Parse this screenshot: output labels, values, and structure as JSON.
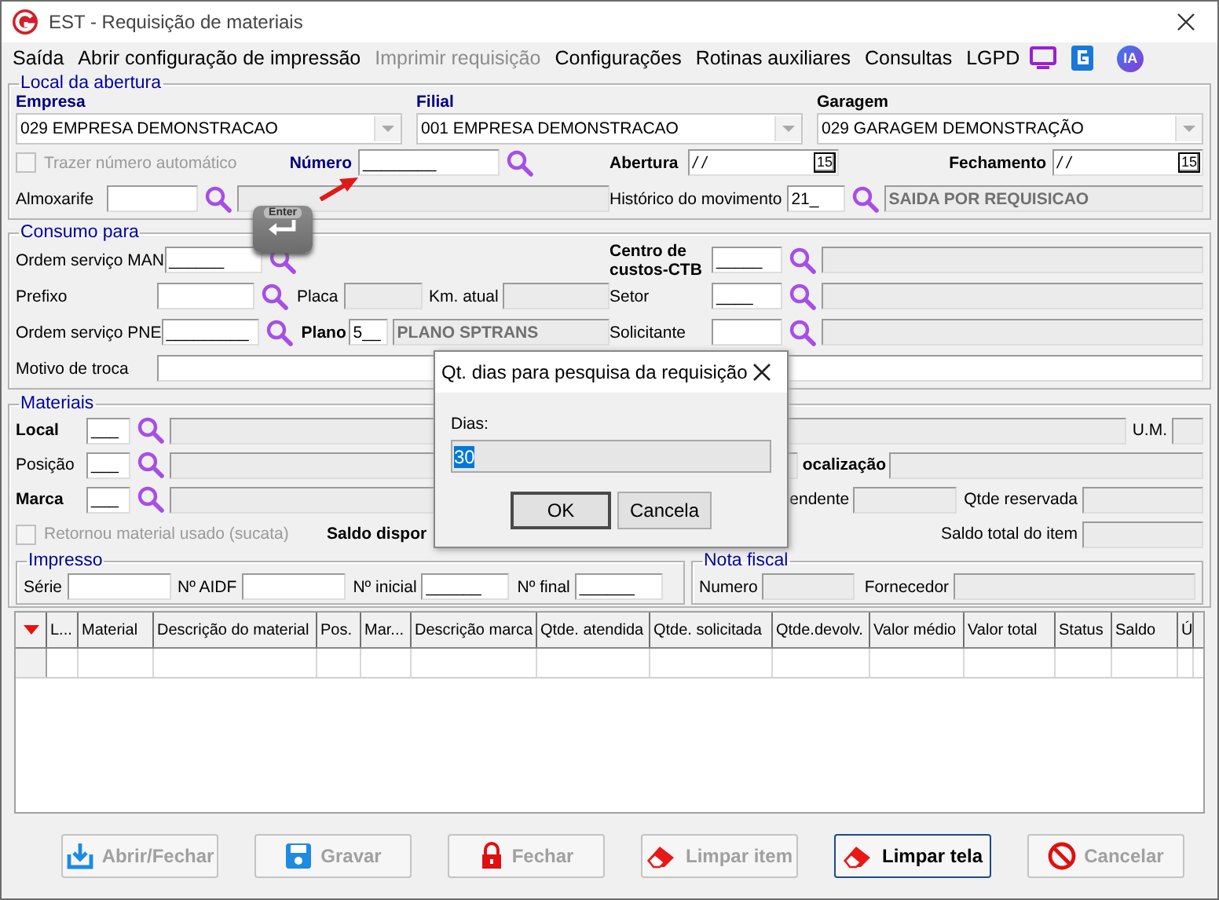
{
  "window": {
    "title": "EST - Requisição de materiais"
  },
  "menu": [
    {
      "label": "Saída",
      "disabled": false
    },
    {
      "label": "Abrir configuração de impressão",
      "disabled": false
    },
    {
      "label": "Imprimir requisição",
      "disabled": true
    },
    {
      "label": "Configurações",
      "disabled": false
    },
    {
      "label": "Rotinas auxiliares",
      "disabled": false
    },
    {
      "label": "Consultas",
      "disabled": false
    },
    {
      "label": "LGPD",
      "disabled": false
    }
  ],
  "menu_badge": "IA",
  "local_abertura": {
    "legend": "Local da abertura",
    "empresa": {
      "label": "Empresa",
      "value": "029 EMPRESA DEMONSTRACAO"
    },
    "filial": {
      "label": "Filial",
      "value": "001 EMPRESA DEMONSTRACAO"
    },
    "garagem": {
      "label": "Garagem",
      "value": "029 GARAGEM DEMONSTRAÇÃO"
    },
    "auto_number": {
      "label": "Trazer número automático",
      "checked": false,
      "disabled": true
    },
    "numero": {
      "label": "Número",
      "value": "________"
    },
    "abertura": {
      "label": "Abertura",
      "value": "/ /",
      "calendar": "15"
    },
    "fechamento": {
      "label": "Fechamento",
      "value": "/ /",
      "calendar": "15"
    },
    "almoxarife": {
      "label": "Almoxarife"
    },
    "historico": {
      "label": "Histórico do movimento",
      "value": "21_",
      "description": "SAIDA POR REQUISICAO"
    }
  },
  "enter_key": "Enter",
  "consumo": {
    "legend": "Consumo para",
    "ordem_man": {
      "label": "Ordem serviço MAN",
      "value": "______"
    },
    "centro_custos": {
      "label": "Centro de custos-CTB",
      "value": "_____"
    },
    "prefixo": {
      "label": "Prefixo"
    },
    "placa": {
      "label": "Placa"
    },
    "km_atual": {
      "label": "Km. atual"
    },
    "setor": {
      "label": "Setor",
      "value": "____"
    },
    "ordem_pne": {
      "label": "Ordem serviço PNE",
      "value": "_________"
    },
    "plano": {
      "label": "Plano",
      "value": "5__",
      "description": "PLANO SPTRANS"
    },
    "solicitante": {
      "label": "Solicitante"
    },
    "motivo": {
      "label": "Motivo de troca"
    }
  },
  "materiais": {
    "legend": "Materiais",
    "local": {
      "label": "Local",
      "value": "___"
    },
    "um": {
      "label": "U.M."
    },
    "posicao": {
      "label": "Posição",
      "value": "___"
    },
    "localizacao": {
      "label": "ocalização"
    },
    "marca": {
      "label": "Marca",
      "value": "___"
    },
    "pendente": {
      "label": "endente"
    },
    "qtde_reservada": {
      "label": "Qtde reservada"
    },
    "retornou": {
      "label": "Retornou material usado (sucata)",
      "checked": false,
      "disabled": true
    },
    "saldo_disponivel": {
      "label": "Saldo dispor"
    },
    "saldo_total": {
      "label": "Saldo total do item"
    },
    "impresso": {
      "legend": "Impresso",
      "serie": {
        "label": "Série"
      },
      "aidf": {
        "label": "Nº AIDF"
      },
      "inicial": {
        "label": "Nº inicial",
        "value": "______"
      },
      "final": {
        "label": "Nº final",
        "value": "______"
      }
    },
    "nota_fiscal": {
      "legend": "Nota fiscal",
      "numero": {
        "label": "Numero"
      },
      "fornecedor": {
        "label": "Fornecedor"
      }
    }
  },
  "table": {
    "columns": [
      "L...",
      "Material",
      "Descrição do material",
      "Pos.",
      "Mar...",
      "Descrição marca",
      "Qtde. atendida",
      "Qtde. solicitada",
      "Qtde.devolv.",
      "Valor médio",
      "Valor total",
      "Status",
      "Saldo",
      "Ú"
    ]
  },
  "buttons": [
    {
      "label": "Abrir/Fechar",
      "kind": "import",
      "disabled": true,
      "focused": false
    },
    {
      "label": "Gravar",
      "kind": "save",
      "disabled": true,
      "focused": false
    },
    {
      "label": "Fechar",
      "kind": "lock",
      "disabled": true,
      "focused": false
    },
    {
      "label": "Limpar item",
      "kind": "eraser",
      "disabled": true,
      "focused": false
    },
    {
      "label": "Limpar tela",
      "kind": "eraser",
      "disabled": false,
      "focused": true
    },
    {
      "label": "Cancelar",
      "kind": "cancel",
      "disabled": true,
      "focused": false
    }
  ],
  "dialog": {
    "title": "Qt. dias para pesquisa da requisição",
    "label": "Dias:",
    "value": "30",
    "buttons": [
      {
        "label": "OK",
        "default": true
      },
      {
        "label": "Cancela",
        "default": false
      }
    ]
  }
}
